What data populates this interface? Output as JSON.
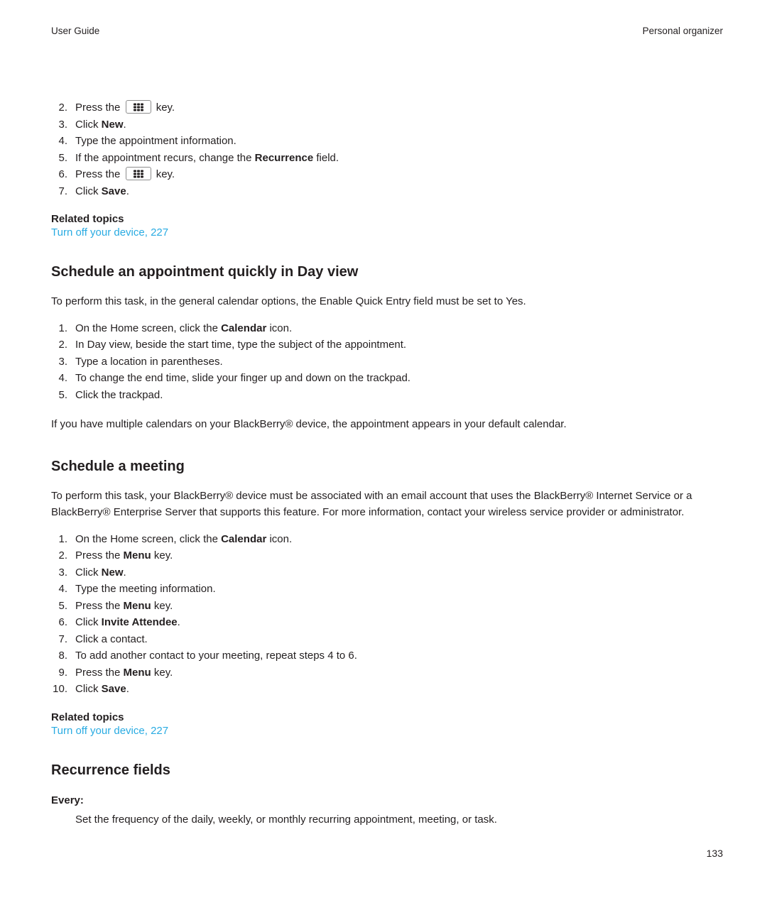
{
  "header": {
    "left": "User Guide",
    "right": "Personal organizer"
  },
  "icons": {
    "menu_key": "blackberry-menu-key-icon"
  },
  "top_list": {
    "items": [
      {
        "num": "2.",
        "pre": "Press the ",
        "key": true,
        "post": " key."
      },
      {
        "num": "3.",
        "pre": "Click ",
        "bold": "New",
        "post": "."
      },
      {
        "num": "4.",
        "pre": "Type the appointment information.",
        "post": ""
      },
      {
        "num": "5.",
        "pre": "If the appointment recurs, change the ",
        "bold": "Recurrence",
        "post": " field."
      },
      {
        "num": "6.",
        "pre": "Press the ",
        "key": true,
        "post": " key."
      },
      {
        "num": "7.",
        "pre": "Click ",
        "bold": "Save",
        "post": "."
      }
    ]
  },
  "related1": {
    "title": "Related topics",
    "link": "Turn off your device, 227"
  },
  "section1": {
    "heading": "Schedule an appointment quickly in Day view",
    "intro": "To perform this task, in the general calendar options, the Enable Quick Entry field must be set to Yes.",
    "steps": [
      {
        "num": "1.",
        "pre": "On the Home screen, click the ",
        "bold": "Calendar",
        "post": " icon."
      },
      {
        "num": "2.",
        "pre": "In Day view, beside the start time, type the subject of the appointment.",
        "post": ""
      },
      {
        "num": "3.",
        "pre": "Type a location in parentheses.",
        "post": ""
      },
      {
        "num": "4.",
        "pre": "To change the end time, slide your finger up and down on the trackpad.",
        "post": ""
      },
      {
        "num": "5.",
        "pre": "Click the trackpad.",
        "post": ""
      }
    ],
    "outro": "If you have multiple calendars on your BlackBerry® device, the appointment appears in your default calendar."
  },
  "section2": {
    "heading": "Schedule a meeting",
    "intro": "To perform this task, your BlackBerry® device must be associated with an email account that uses the BlackBerry® Internet Service or a BlackBerry® Enterprise Server that supports this feature. For more information, contact your wireless service provider or administrator.",
    "steps": [
      {
        "num": "1.",
        "pre": "On the Home screen, click the ",
        "bold": "Calendar",
        "post": " icon."
      },
      {
        "num": "2.",
        "pre": "Press the ",
        "bold": "Menu",
        "post": " key."
      },
      {
        "num": "3.",
        "pre": "Click ",
        "bold": "New",
        "post": "."
      },
      {
        "num": "4.",
        "pre": "Type the meeting information.",
        "post": ""
      },
      {
        "num": "5.",
        "pre": "Press the ",
        "bold": "Menu",
        "post": " key."
      },
      {
        "num": "6.",
        "pre": "Click ",
        "bold": "Invite Attendee",
        "post": "."
      },
      {
        "num": "7.",
        "pre": "Click a contact.",
        "post": ""
      },
      {
        "num": "8.",
        "pre": "To add another contact to your meeting, repeat steps 4 to 6.",
        "post": ""
      },
      {
        "num": "9.",
        "pre": "Press the ",
        "bold": "Menu",
        "post": " key."
      },
      {
        "num": "10.",
        "pre": "Click ",
        "bold": "Save",
        "post": "."
      }
    ]
  },
  "related2": {
    "title": "Related topics",
    "link": "Turn off your device, 227"
  },
  "section3": {
    "heading": "Recurrence fields",
    "term": "Every:",
    "definition": "Set the frequency of the daily, weekly, or monthly recurring appointment, meeting, or task."
  },
  "page_number": "133",
  "colors": {
    "link": "#29abe2",
    "text": "#231f20"
  }
}
